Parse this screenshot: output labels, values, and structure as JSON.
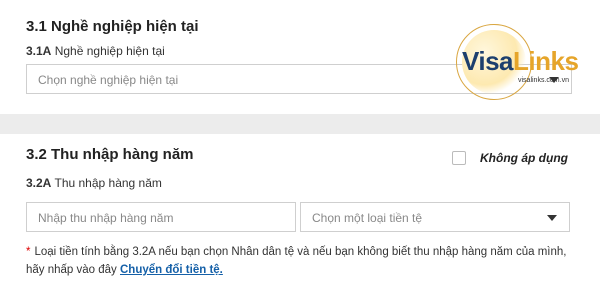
{
  "occupation": {
    "title": "3.1 Nghề nghiệp hiện tại",
    "field_code": "3.1A",
    "field_label": "Nghề nghiệp hiện tại",
    "select_placeholder": "Chọn nghề nghiệp hiện tại"
  },
  "income": {
    "title": "3.2 Thu nhập hàng năm",
    "not_applicable_label": "Không áp dụng",
    "not_applicable_checked": false,
    "field_code": "3.2A",
    "field_label": "Thu nhập hàng năm",
    "amount_placeholder": "Nhập thu nhập hàng năm",
    "currency_placeholder": "Chọn một loại tiền tệ"
  },
  "note": {
    "star": "*",
    "text": "Loại tiền tính bằng 3.2A nếu bạn chọn Nhân dân tệ và nếu bạn không biết thu nhập hàng năm của mình, hãy nhấp vào đây",
    "link": "Chuyển đổi tiền tệ."
  },
  "logo": {
    "part1": "Visa",
    "part2": "Links",
    "url": "visalinks.com.vn"
  },
  "colors": {
    "link": "#1560a8",
    "required_star": "#dd0000",
    "logo_blue": "#1d3f6e",
    "logo_gold": "#e6a52a",
    "band": "#ececec"
  },
  "icons": {
    "dropdown": "chevron-down-icon",
    "checkbox": "checkbox-icon"
  }
}
